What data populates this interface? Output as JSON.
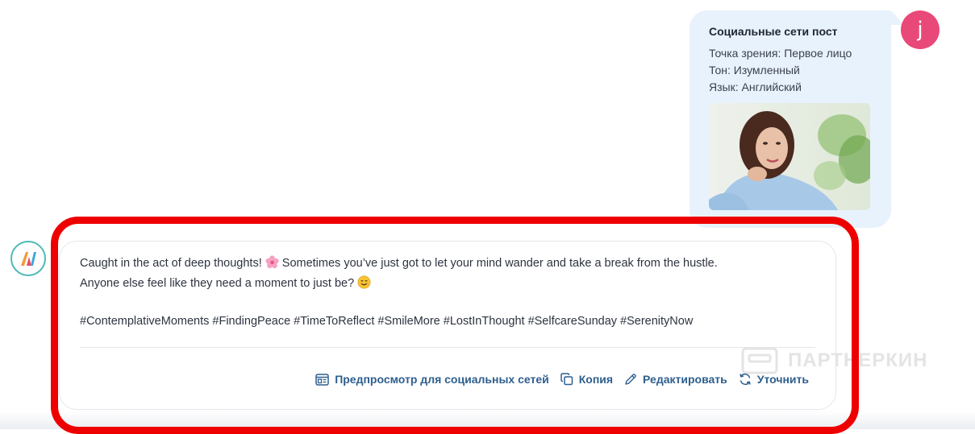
{
  "user_message": {
    "title": "Социальные сети пост",
    "lines": [
      "Точка зрения: Первое лицо",
      "Тон: Изумленный",
      "Язык: Английский"
    ],
    "avatar_letter": "j"
  },
  "ai_message": {
    "line1": "Caught in the act of deep thoughts! ",
    "line1b": " Sometimes you’ve just got to let your mind wander and take a break from the hustle.",
    "line2": "Anyone else feel like they need a moment to just be? ",
    "hashtags": "#ContemplativeMoments #FindingPeace #TimeToReflect #SmileMore #LostInThought #SelfcareSunday #SerenityNow"
  },
  "actions": {
    "preview": "Предпросмотр для социальных сетей",
    "copy": "Копия",
    "edit": "Редактировать",
    "refine": "Уточнить"
  },
  "watermark": "ПАРТНЕРКИН",
  "colors": {
    "highlight": "#ee0000",
    "user_bubble": "#e8f2fd",
    "user_avatar": "#e94978",
    "action_text": "#2e5f8e",
    "ai_avatar_border": "#4fb9b6"
  }
}
